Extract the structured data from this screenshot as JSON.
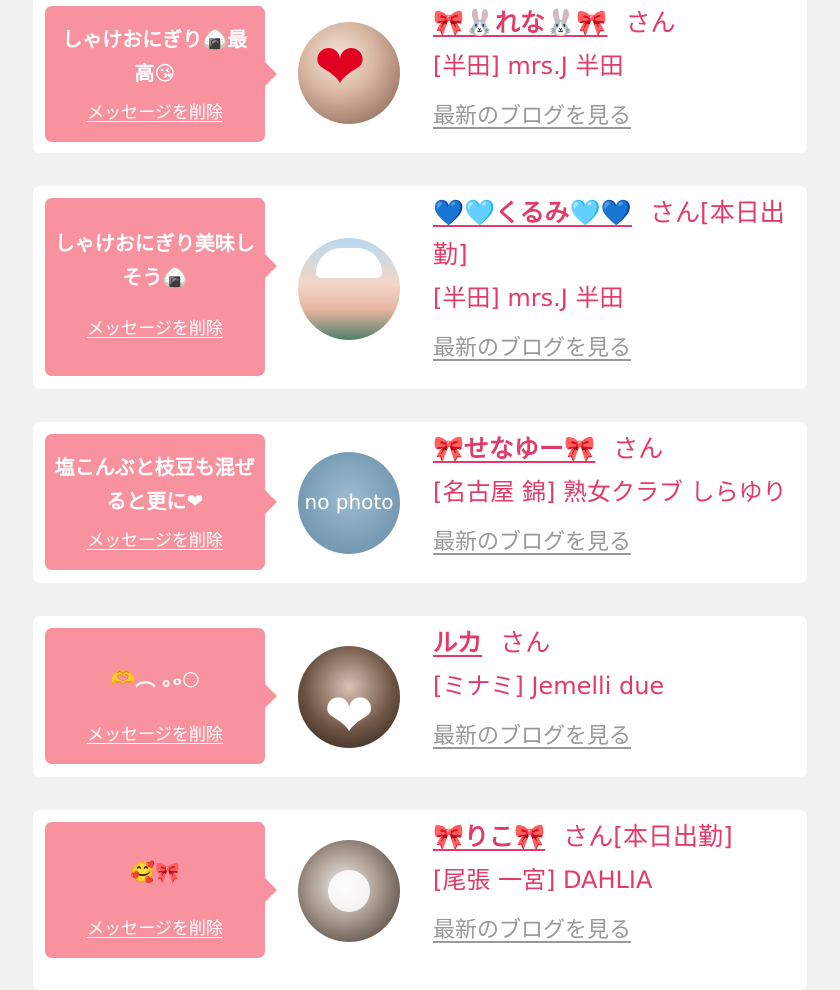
{
  "colors": {
    "background": "#f1f1f1",
    "card": "#ffffff",
    "bubble": "#f8929f",
    "accent": "#e33a6a",
    "link_gray": "#999999"
  },
  "messages": [
    {
      "text": "しゃけおにぎり🍙最高😘",
      "delete_label": "メッセージを削除",
      "name": "🎀🐰れな🐰🎀",
      "honorific": "さん",
      "shop": "[半田] mrs.J 半田",
      "blog_link": "最新のブログを見る",
      "avatar_icon": "avatar-photo-heart"
    },
    {
      "text": "しゃけおにぎり美味しそう🍙",
      "delete_label": "メッセージを削除",
      "name": "💙🩵くるみ🩵💙",
      "honorific": "さん[本日出勤]",
      "shop": "[半田] mrs.J 半田",
      "blog_link": "最新のブログを見る",
      "avatar_icon": "avatar-photo-cap"
    },
    {
      "text": "塩こんぶと枝豆も混ぜると更に❤",
      "delete_label": "メッセージを削除",
      "name": "🎀せなゆー🎀",
      "honorific": "さん",
      "shop": "[名古屋 錦] 熟女クラブ しらゆり",
      "blog_link": "最新のブログを見る",
      "avatar_icon": "avatar-no-photo",
      "avatar_text": "no photo"
    },
    {
      "text": "🫶︵ ｡ₒ○",
      "delete_label": "メッセージを削除",
      "name": "ルカ",
      "honorific": "さん",
      "shop": "[ミナミ] Jemelli due",
      "blog_link": "最新のブログを見る",
      "avatar_icon": "avatar-photo-white-heart"
    },
    {
      "text": "🥰🎀",
      "delete_label": "メッセージを削除",
      "name": "🎀りこ🎀",
      "honorific": "さん[本日出勤]",
      "shop": "[尾張 一宮] DAHLIA",
      "blog_link": "最新のブログを見る",
      "avatar_icon": "avatar-photo-blurred"
    }
  ]
}
